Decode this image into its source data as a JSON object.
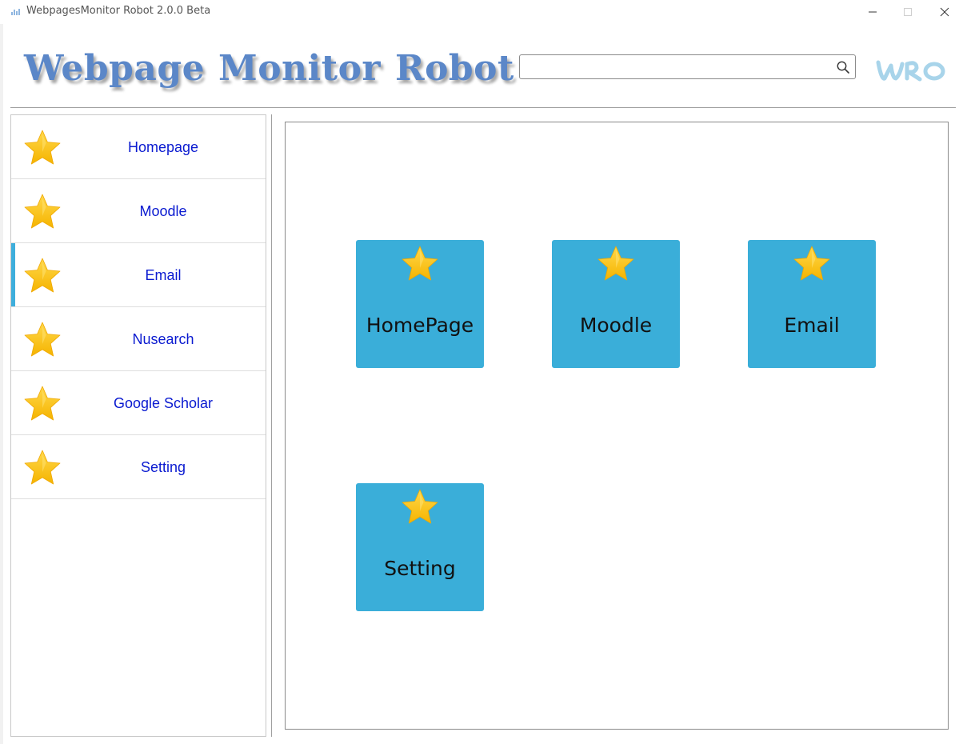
{
  "window": {
    "title": "WebpagesMonitor Robot 2.0.0 Beta"
  },
  "header": {
    "brand_words": [
      "Webpage",
      "Monitor",
      "Robot"
    ],
    "search": {
      "value": "",
      "placeholder": ""
    },
    "logo_text": "WRO"
  },
  "sidebar": {
    "items": [
      {
        "label": "Homepage",
        "icon": "star-icon",
        "active": false
      },
      {
        "label": "Moodle",
        "icon": "star-icon",
        "active": false
      },
      {
        "label": "Email",
        "icon": "star-icon",
        "active": true
      },
      {
        "label": "Nusearch",
        "icon": "star-icon",
        "active": false
      },
      {
        "label": "Google Scholar",
        "icon": "star-icon",
        "active": false
      },
      {
        "label": "Setting",
        "icon": "star-icon",
        "active": false
      }
    ]
  },
  "main": {
    "tiles": [
      {
        "label": "HomePage",
        "icon": "star-icon"
      },
      {
        "label": "Moodle",
        "icon": "star-icon"
      },
      {
        "label": "Email",
        "icon": "star-icon"
      },
      {
        "label": "Setting",
        "icon": "star-icon"
      }
    ]
  },
  "colors": {
    "accent": "#3aaed9",
    "brand_text": "#5b87c8",
    "nav_text": "#0a1ad0",
    "star": "#ffc107"
  }
}
